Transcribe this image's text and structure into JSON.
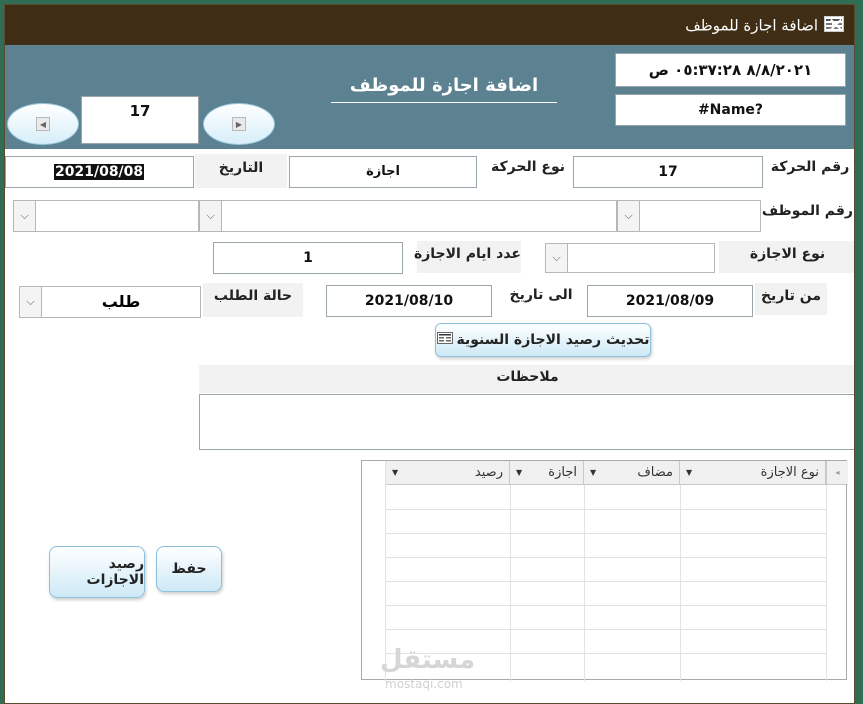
{
  "window": {
    "title": "اضافة  اجازة للموظف",
    "close_glyph": "✕"
  },
  "header": {
    "form_title": "اضافة   اجازة للموظف",
    "datetime": "٨/٨/٢٠٢١ ٠٥:٣٧:٢٨ ص",
    "name_field": "#Name?",
    "record_number": "17"
  },
  "form": {
    "movement_no": {
      "label": "رقم الحركة",
      "value": "17"
    },
    "movement_type": {
      "label": "نوع الحركة",
      "value": "اجازة"
    },
    "date": {
      "label": "التاريخ",
      "value": "2021/08/08"
    },
    "employee_no": {
      "label": "رقم الموظف",
      "value": ""
    },
    "leave_type": {
      "label": "نوع الاجازة",
      "value": ""
    },
    "leave_days": {
      "label": "عدد ايام الاجازة",
      "value": "1"
    },
    "from_date": {
      "label": "من تاريخ",
      "value": "2021/08/09"
    },
    "to_date": {
      "label": "الى تاريخ",
      "value": "2021/08/10"
    },
    "request_status": {
      "label": "حالة الطلب",
      "value": "طلب"
    },
    "notes": {
      "label": "ملاحظات",
      "value": ""
    }
  },
  "buttons": {
    "update_balance": "تحديث رصيد الاجازة السنوية",
    "save": "حفظ",
    "leave_balance": "رصيد الاجازات"
  },
  "datasheet": {
    "columns": [
      "نوع الاجازة",
      "مضاف",
      "اجازة",
      "رصيد"
    ],
    "rows": []
  },
  "watermark": {
    "text": "مستقل",
    "domain": "mostaqi.com"
  },
  "icons": {
    "nav_prev": "triangle-left-icon",
    "nav_next": "triangle-right-icon",
    "dropdown": "chevron-down-icon",
    "form": "form-icon"
  }
}
